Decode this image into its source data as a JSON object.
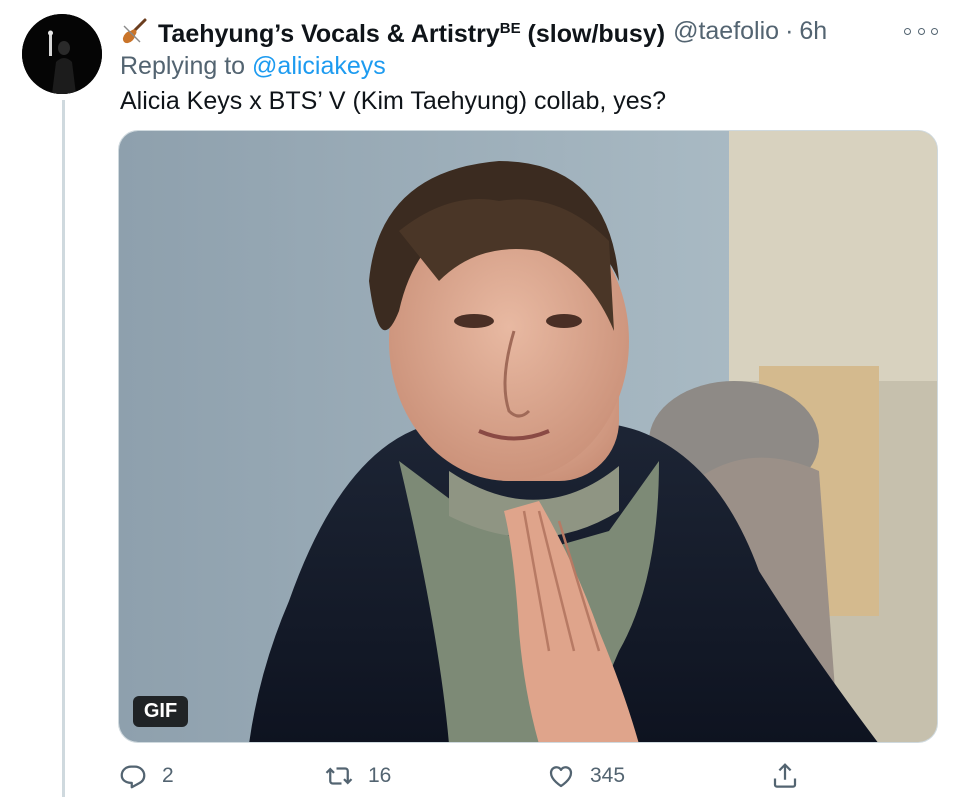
{
  "tweet": {
    "display_name": "Taehyung’s Vocals & Artistry",
    "display_name_sup": "BE",
    "display_name_suffix": " (slow/busy)",
    "handle": "@taefolio",
    "separator": "·",
    "time": "6h",
    "replying_prefix": "Replying to ",
    "replying_to": "@aliciakeys",
    "text": "Alicia Keys x BTS’ V (Kim Taehyung) collab, yes?",
    "media_badge": "GIF",
    "icons": {
      "name_emoji": "violin-icon",
      "more": "more-icon",
      "reply": "reply-icon",
      "retweet": "retweet-icon",
      "like": "heart-icon",
      "share": "share-icon"
    }
  },
  "actions": {
    "reply_count": "2",
    "retweet_count": "16",
    "like_count": "345"
  },
  "colors": {
    "link": "#1d9bf0",
    "secondary_text": "#536471",
    "thread_line": "#cfd9de"
  }
}
